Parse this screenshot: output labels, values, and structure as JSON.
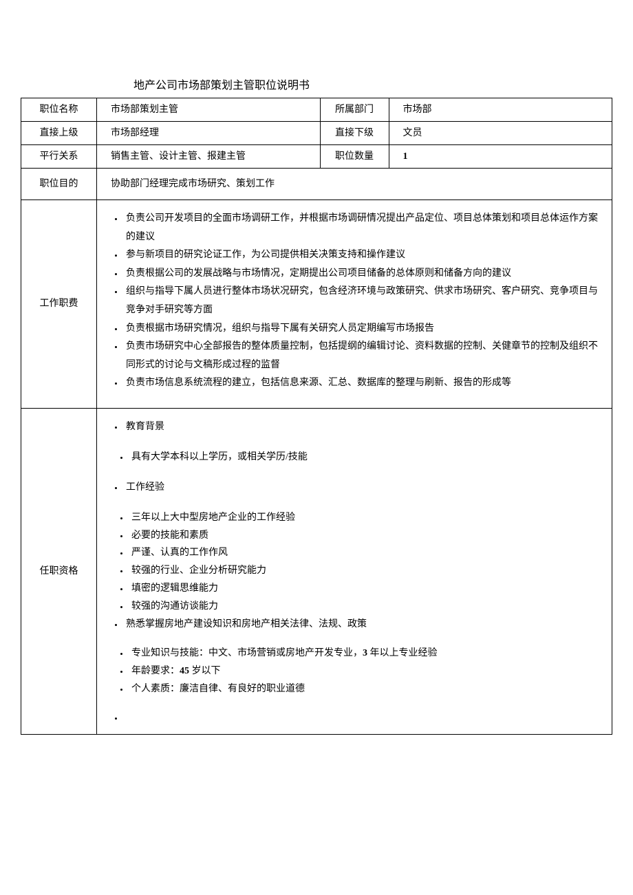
{
  "title": "地产公司市场部策划主管职位说明书",
  "rows": {
    "r1": {
      "l1": "职位名称",
      "v1": "市场部策划主管",
      "l2": "所属部门",
      "v2": "市场部"
    },
    "r2": {
      "l1": "直接上级",
      "v1": "市场部经理",
      "l2": "直接下级",
      "v2": "文员"
    },
    "r3": {
      "l1": "平行关系",
      "v1": "销售主管、设计主管、报建主管",
      "l2": "职位数量",
      "v2": "1"
    },
    "r4": {
      "l1": "职位目的",
      "v1": "协助部门经理完成市场研究、策划工作"
    },
    "r5": {
      "l1": "工作职费"
    },
    "r6": {
      "l1": "任职资格"
    }
  },
  "duties": [
    "负责公司开发项目的全面市场调研工作，并根据市场调研情况提出产品定位、项目总体策划和项目总体运作方案的建议",
    "参与新项目的研究论证工作，为公司提供相关决策支持和操作建议",
    "负责根据公司的发展战略与市场情况，定期提出公司项目储备的总体原则和储备方向的建议",
    "组织与指导下属人员进行整体市场状况研究，包含经济环境与政策研究、供求市场研究、客户研究、竞争项目与竞争对手研究等方面",
    "负责根据市场研究情况，组织与指导下属有关研究人员定期编写市场报告",
    "负责市场研究中心全部报告的整体质量控制，包括提纲的编辑讨论、资料数据的控制、关健章节的控制及组织不同形式的讨论与文稿形成过程的监督",
    "负责市场信息系统流程的建立，包括信息来源、汇总、数据库的整理与刷新、报告的形成等"
  ],
  "qual": {
    "h1": "教育背景",
    "q1": "具有大学本科以上学历，或相关学历/技能",
    "h2": "工作经验",
    "q2": "三年以上大中型房地产企业的工作经验",
    "q3": "必要的技能和素质",
    "q4": "严谨、认真的工作作风",
    "q5": "较强的行业、企业分析研究能力",
    "q6": "填密的逻辑思维能力",
    "q7": "较强的沟通访谈能力",
    "q8": "熟悉掌握房地产建设知识和房地产相关法律、法规、政策",
    "q9_a": "专业知识与技能：中文、市场营销或房地产开发专业，",
    "q9_b": "3",
    "q9_c": " 年以上专业经验",
    "q10_a": "年龄要求：",
    "q10_b": "45",
    "q10_c": " 岁以下",
    "q11": "个人素质：廉洁自律、有良好的职业道德"
  }
}
